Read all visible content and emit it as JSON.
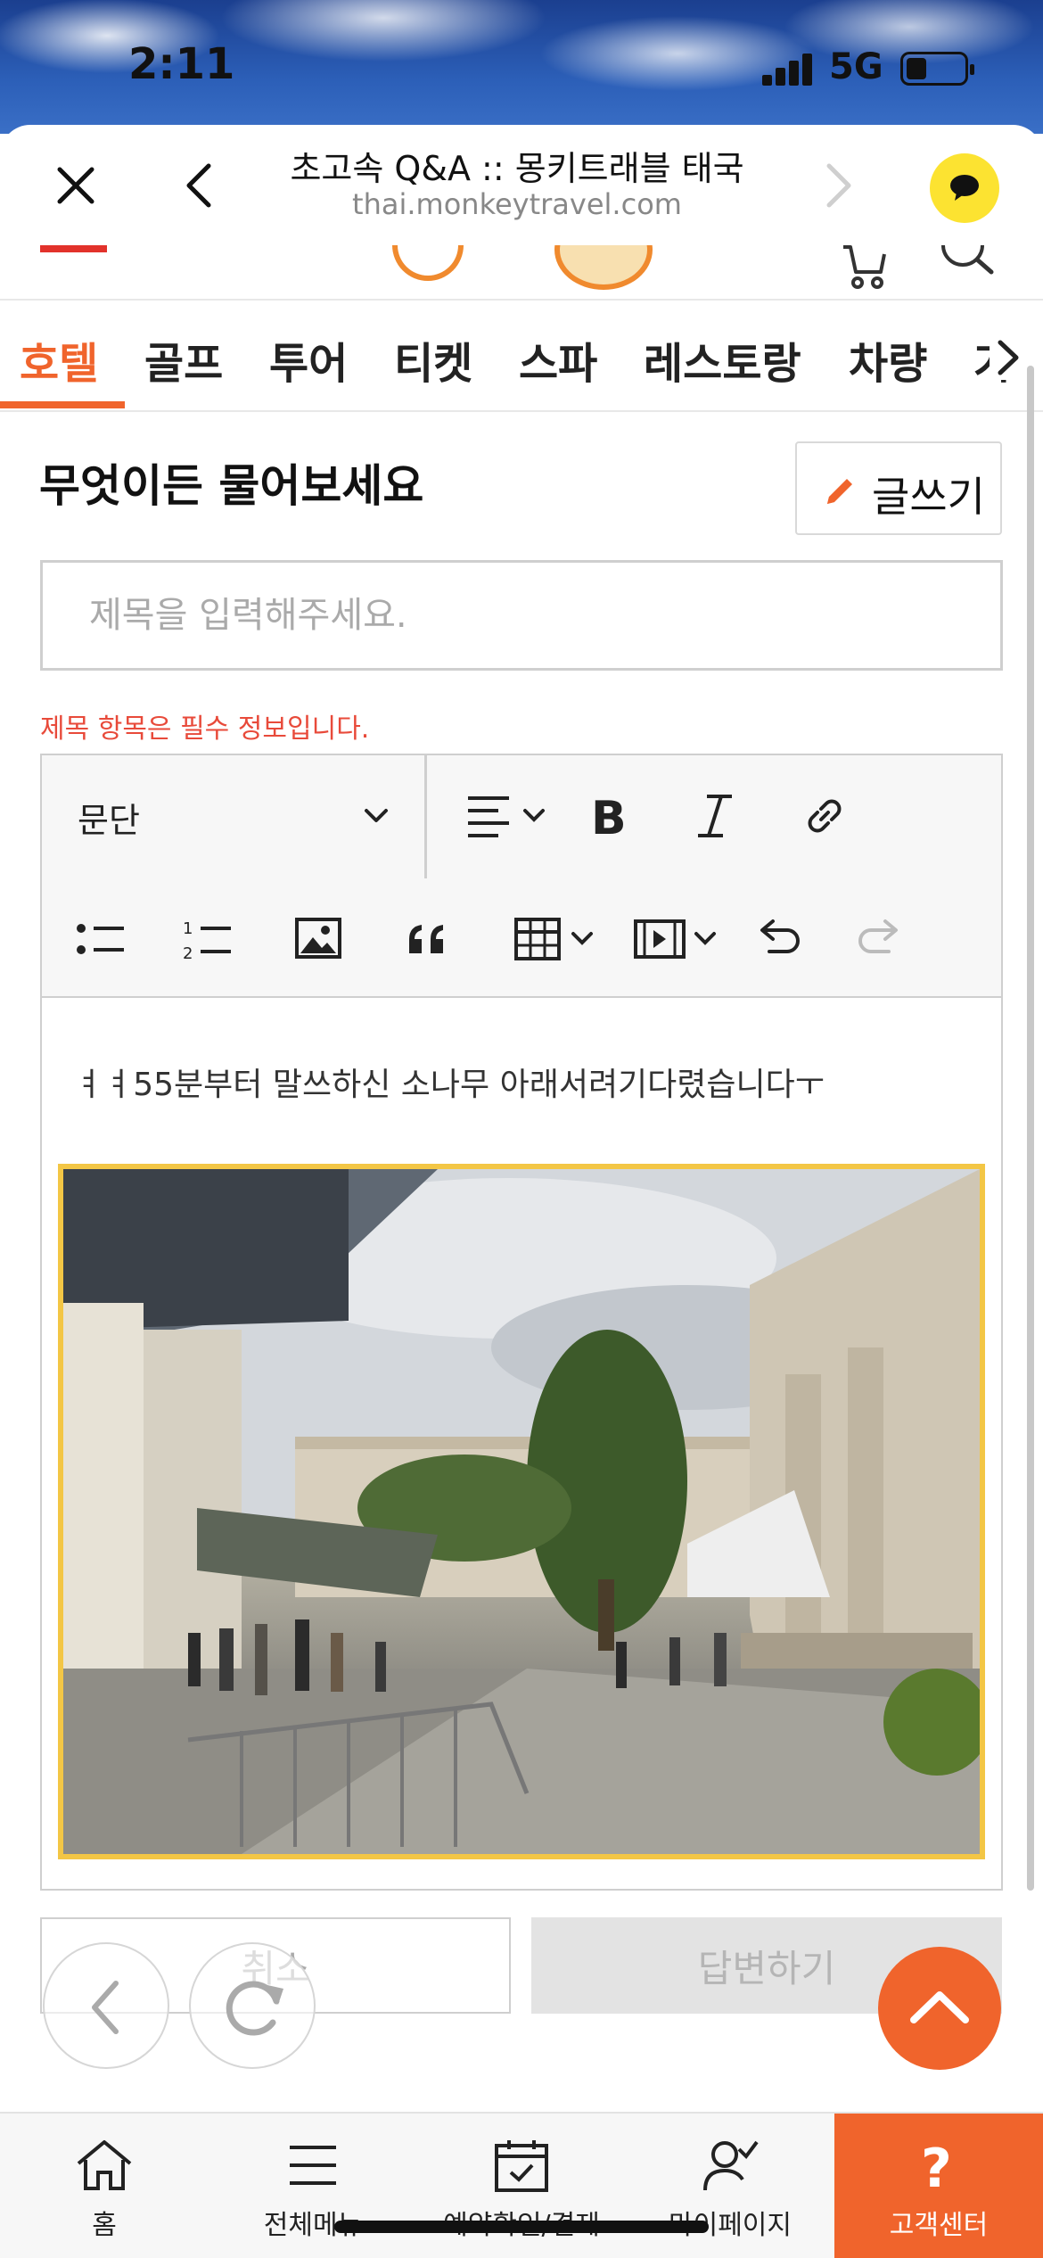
{
  "status": {
    "time": "2:11",
    "network": "5G"
  },
  "browser": {
    "title": "초고속 Q&A :: 몽키트래블 태국",
    "url": "thai.monkeytravel.com"
  },
  "tabs": [
    "호텔",
    "골프",
    "투어",
    "티켓",
    "스파",
    "레스토랑",
    "차량",
    "가"
  ],
  "page": {
    "heading": "무엇이든 물어보세요",
    "write_button": "글쓰기",
    "title_placeholder": "제목을 입력해주세요.",
    "error": "제목 항목은 필수 정보입니다."
  },
  "editor": {
    "paragraph_select": "문단",
    "content": "ㅕㅕ55분부터 말쓰하신 소나무 아래서려기다렸습니다ㅜ"
  },
  "buttons": {
    "cancel": "취소",
    "answer": "답변하기"
  },
  "bottom_nav": {
    "home": "홈",
    "menu": "전체메뉴",
    "booking": "예약확인/결제",
    "mypage": "마이페이지",
    "support": "고객센터"
  },
  "colors": {
    "accent": "#f0642c",
    "error": "#e84a3a",
    "photo_border": "#f3c645",
    "kakao": "#fce331"
  }
}
